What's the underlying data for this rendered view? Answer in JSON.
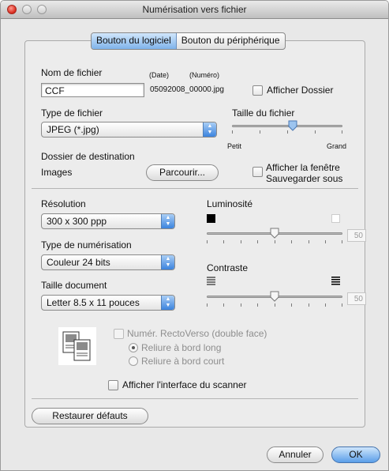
{
  "window": {
    "title": "Numérisation vers fichier"
  },
  "tabs": [
    {
      "label": "Bouton du logiciel",
      "active": true
    },
    {
      "label": "Bouton du périphérique",
      "active": false
    }
  ],
  "file_name": {
    "label": "Nom de fichier",
    "value": "CCF",
    "date_label": "(Date)",
    "number_label": "(Numéro)",
    "sample_name": "05092008_00000.jpg",
    "show_folder_label": "Afficher Dossier"
  },
  "file_type": {
    "label": "Type de fichier",
    "value": "JPEG (*.jpg)"
  },
  "file_size": {
    "label": "Taille du fichier",
    "min_label": "Petit",
    "max_label": "Grand",
    "level_percent": 55
  },
  "destination": {
    "label": "Dossier de destination",
    "value": "Images",
    "browse_label": "Parcourir...",
    "save_as_line1": "Afficher la fenêtre",
    "save_as_line2": "Sauvegarder sous"
  },
  "resolution": {
    "label": "Résolution",
    "value": "300 x 300 ppp"
  },
  "scan_type": {
    "label": "Type de numérisation",
    "value": "Couleur 24 bits"
  },
  "doc_size": {
    "label": "Taille document",
    "value": "Letter  8.5 x 11 pouces"
  },
  "brightness": {
    "label": "Luminosité",
    "value": "50"
  },
  "contrast": {
    "label": "Contraste",
    "value": "50"
  },
  "duplex": {
    "label": "Numér. RectoVerso (double face)",
    "long_edge": "Reliure à bord long",
    "short_edge": "Reliure à bord court"
  },
  "show_scanner_ui": "Afficher l'interface du scanner",
  "restore_defaults": "Restaurer défauts",
  "cancel": "Annuler",
  "ok": "OK",
  "colors": {
    "accent": "#5a9ee9",
    "close": "#d8281b"
  }
}
